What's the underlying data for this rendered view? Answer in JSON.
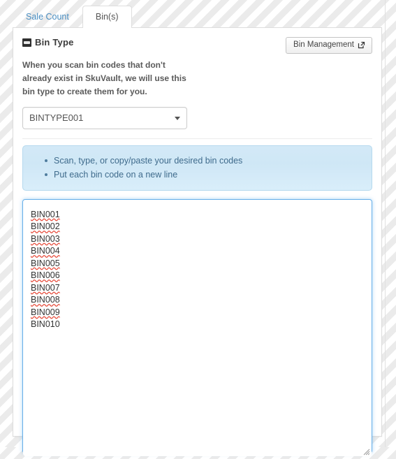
{
  "tabs": [
    {
      "label": "Sale Count",
      "active": false,
      "name": "tab-sale-count"
    },
    {
      "label": "Bin(s)",
      "active": true,
      "name": "tab-bins"
    }
  ],
  "panel": {
    "heading": "Bin Type",
    "heading_icon": "box-icon",
    "description": "When you scan bin codes that don't already exist in SkuVault, we will use this bin type to create them for you.",
    "bin_management_button": {
      "label": "Bin Management",
      "icon": "external-link-icon"
    },
    "bin_type_select": {
      "value": "BINTYPE001",
      "options": [
        "BINTYPE001"
      ],
      "caret_icon": "chevron-down-icon"
    },
    "info_box": {
      "items": [
        "Scan, type, or copy/paste your desired bin codes",
        "Put each bin code on a new line"
      ]
    },
    "bin_codes_textarea": {
      "placeholder": "",
      "value": "BIN001\nBIN002\nBIN003\nBIN004\nBIN005\nBIN006\nBIN007\nBIN008\nBIN009\nBIN010",
      "lines": [
        {
          "text": "BIN001",
          "misspelled": true
        },
        {
          "text": "BIN002",
          "misspelled": true
        },
        {
          "text": "BIN003",
          "misspelled": true
        },
        {
          "text": "BIN004",
          "misspelled": true
        },
        {
          "text": "BIN005",
          "misspelled": true
        },
        {
          "text": "BIN006",
          "misspelled": true
        },
        {
          "text": "BIN007",
          "misspelled": true
        },
        {
          "text": "BIN008",
          "misspelled": true
        },
        {
          "text": "BIN009",
          "misspelled": true
        },
        {
          "text": "BIN010",
          "misspelled": false
        }
      ]
    }
  },
  "colors": {
    "accent_blue": "#66afe9",
    "tab_link": "#4a8ec2",
    "info_bg": "#d3e9f7",
    "info_text": "#3f6b8c",
    "spellcheck_red": "#e74c3c",
    "panel_border": "#dddddd"
  }
}
